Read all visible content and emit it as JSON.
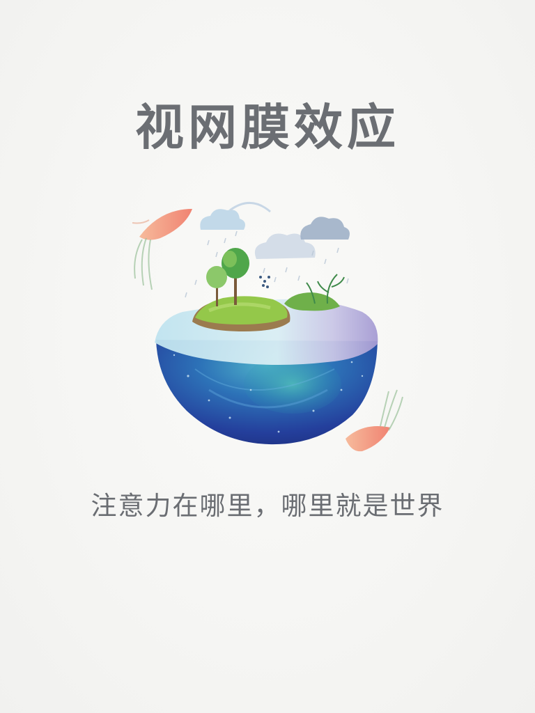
{
  "poster": {
    "title": "视网膜效应",
    "subtitle": "注意力在哪里，哪里就是世界",
    "illustration": {
      "subject": "watercolor-half-globe-island",
      "icons": [
        "cloud-icon",
        "tree-icon",
        "fish-icon",
        "rain-icon",
        "plant-icon"
      ]
    },
    "colors": {
      "background": "#f6f6f4",
      "text": "#6b6e73",
      "ocean": "#2a55a8",
      "grass": "#8cc63f",
      "fish": "#f08a6a"
    }
  }
}
